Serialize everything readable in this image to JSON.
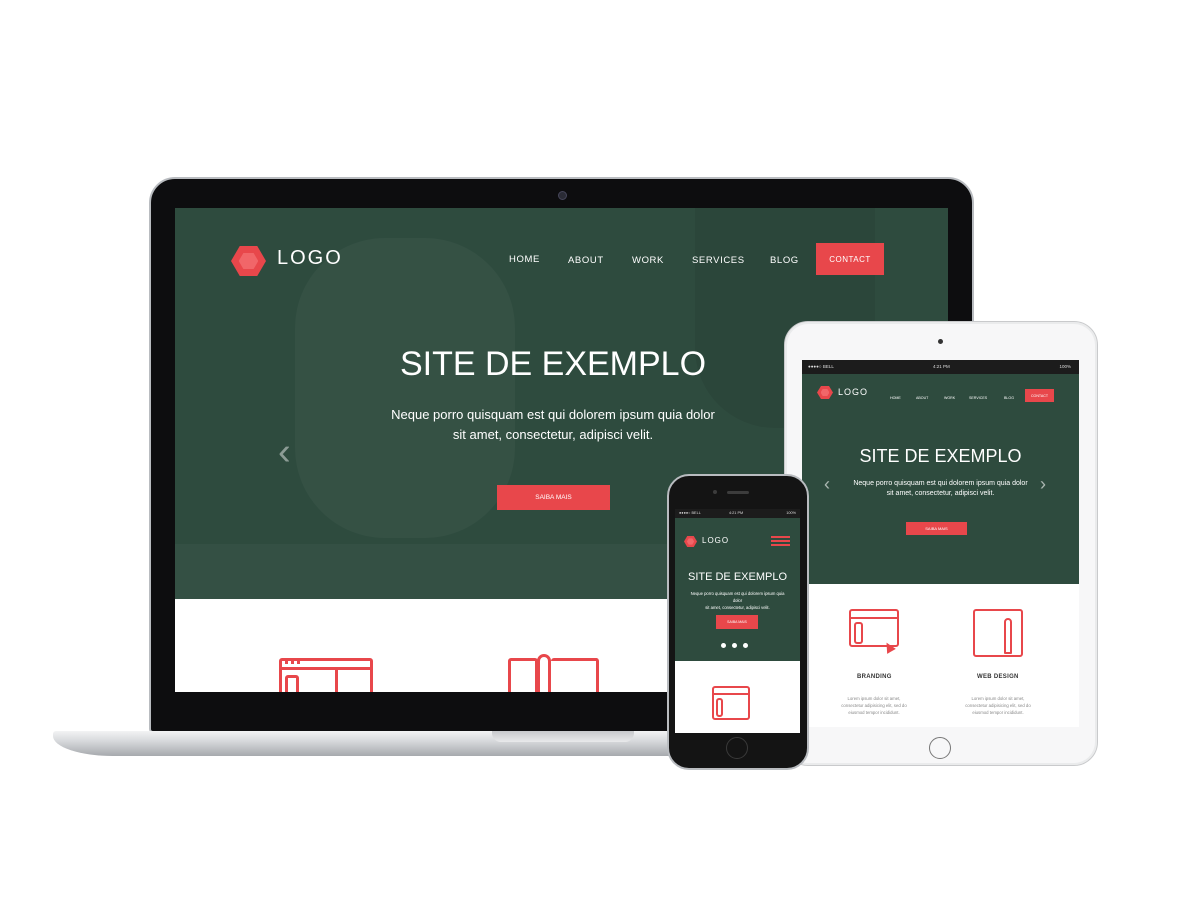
{
  "brand": {
    "accent": "#e8474b",
    "hero_green": "#2e4b3e"
  },
  "logo": {
    "text": "LOGO"
  },
  "nav": {
    "home": "HOME",
    "about": "ABOUT",
    "work": "WORK",
    "services": "SERVICES",
    "blog": "BLOG",
    "contact": "CONTACT"
  },
  "hero": {
    "title": "SITE DE EXEMPLO",
    "subtitle_line1": "Neque porro quisquam est qui dolorem ipsum quia dolor",
    "subtitle_line2": "sit amet, consectetur, adipisci velit.",
    "cta": "SAIBA MAIS",
    "prev_icon": "chevron-left-icon",
    "next_icon": "chevron-right-icon"
  },
  "status_bar": {
    "carrier": "●●●●○ BELL",
    "time": "4:21 PM",
    "battery": "100%"
  },
  "features": [
    {
      "label": "BRANDING",
      "text_line1": "Lorem ipsum dolor sit amet,",
      "text_line2": "consectetur adipisicing elit, sed do",
      "text_line3": "eiusmod tempor incididunt."
    },
    {
      "label": "WEB DESIGN",
      "text_line1": "Lorem ipsum dolor sit amet,",
      "text_line2": "consectetur adipisicing elit, sed do",
      "text_line3": "eiusmod tempor incididunt."
    }
  ]
}
